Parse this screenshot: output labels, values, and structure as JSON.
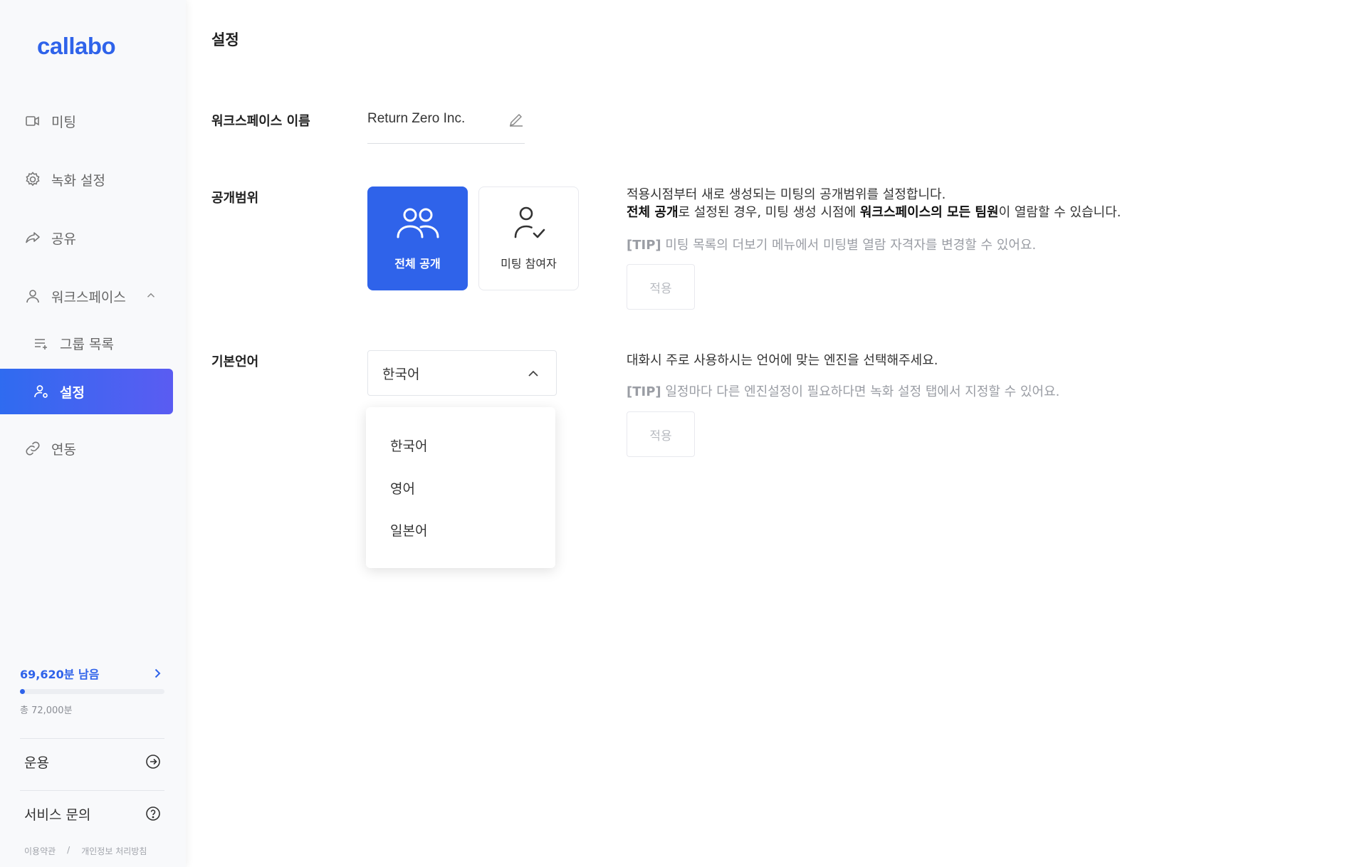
{
  "app": {
    "logo": "callabo"
  },
  "sidebar": {
    "items": [
      {
        "label": "미팅",
        "icon": "video-icon"
      },
      {
        "label": "녹화 설정",
        "icon": "gear-icon"
      },
      {
        "label": "공유",
        "icon": "share-icon"
      },
      {
        "label": "워크스페이스",
        "icon": "user-icon"
      },
      {
        "label": "그룹 목록",
        "icon": "list-add-icon"
      },
      {
        "label": "설정",
        "icon": "user-settings-icon"
      },
      {
        "label": "연동",
        "icon": "link-icon"
      }
    ],
    "active": "설정",
    "quota": {
      "remaining": "69,620분 남음",
      "total": "총 72,000분",
      "used_fraction": 0.033
    },
    "footer": {
      "billing": "운용",
      "support": "서비스 문의",
      "terms": "이용약관",
      "separator": "/",
      "privacy": "개인정보 처리방침"
    }
  },
  "main": {
    "title": "설정",
    "workspace": {
      "label": "워크스페이스 이름",
      "value": "Return Zero Inc."
    },
    "scope": {
      "label": "공개범위",
      "options": [
        {
          "label": "전체 공개",
          "icon": "group-icon",
          "selected": true
        },
        {
          "label": "미팅 참여자",
          "icon": "user-check-icon",
          "selected": false
        }
      ],
      "desc_line1": "적용시점부터 새로 생성되는 미팅의 공개범위를 설정합니다.",
      "desc_line2_b1": "전체 공개",
      "desc_line2_t1": "로 설정된 경우, 미팅 생성 시점에 ",
      "desc_line2_b2": "워크스페이스의 모든 팀원",
      "desc_line2_t2": "이 열람할 수 있습니다.",
      "tip_tag": "[TIP]",
      "tip_text": " 미팅 목록의 더보기 메뉴에서 미팅별 열람 자격자를 변경할 수 있어요.",
      "apply": "적용"
    },
    "language": {
      "label": "기본언어",
      "selected": "한국어",
      "options": [
        "한국어",
        "영어",
        "일본어"
      ],
      "desc": "대화시 주로 사용하시는 언어에 맞는 엔진을 선택해주세요.",
      "tip_tag": "[TIP]",
      "tip_text": " 일정마다 다른 엔진설정이 필요하다면 녹화 설정 탭에서 지정할 수 있어요.",
      "apply": "적용"
    }
  },
  "colors": {
    "accent": "#2f63ea",
    "accent_gradient_end": "#5a5cf2",
    "muted": "#9a9da4"
  }
}
